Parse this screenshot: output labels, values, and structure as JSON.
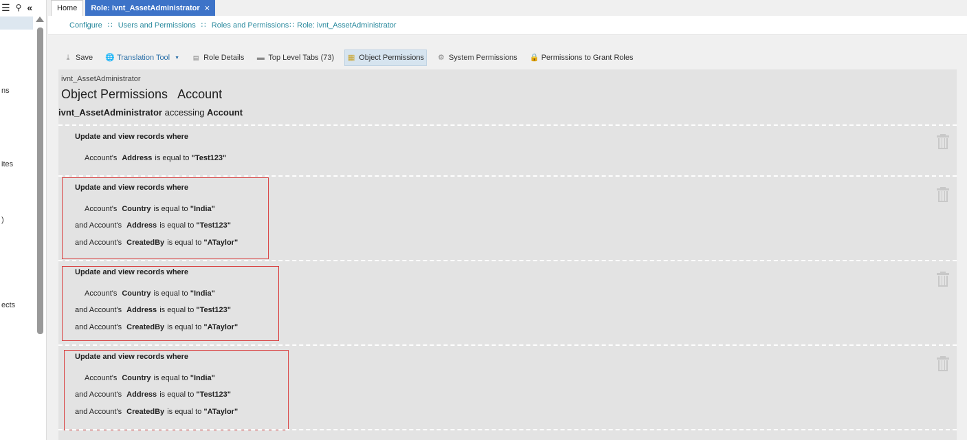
{
  "sidebar": {
    "tools": [
      "☰",
      "🔍",
      "«"
    ],
    "labels": [
      "ns",
      "ites",
      ")",
      "ects"
    ]
  },
  "tabs": {
    "home": "Home",
    "active": "Role: ivnt_AssetAdministrator",
    "close": "×"
  },
  "breadcrumb": [
    "Configure",
    "Users and Permissions",
    "Roles and Permissions",
    "Role: ivnt_AssetAdministrator"
  ],
  "breadcrumb_sep": "∷",
  "toolbar": {
    "save": "Save",
    "translation_tool": "Translation Tool",
    "role_details": "Role Details",
    "top_level_tabs": "Top Level Tabs (73)",
    "object_permissions": "Object Permissions",
    "system_permissions": "System Permissions",
    "permissions_to_grant_roles": "Permissions to Grant Roles"
  },
  "panel": {
    "role_small": "ivnt_AssetAdministrator",
    "title": "Object Permissions",
    "object": "Account",
    "accessing_role": "ivnt_AssetAdministrator",
    "accessing_word": "accessing",
    "accessing_object": "Account"
  },
  "blocks": [
    {
      "title": "Update and view records where",
      "conditions": [
        {
          "prefix": "Account's",
          "field": "Address",
          "op": "is equal to",
          "value": "\"Test123\""
        }
      ]
    },
    {
      "title": "Update and view records where",
      "conditions": [
        {
          "prefix": "Account's",
          "field": "Country",
          "op": "is equal to",
          "value": "\"India\""
        },
        {
          "prefix": "and Account's",
          "field": "Address",
          "op": "is equal to",
          "value": "\"Test123\""
        },
        {
          "prefix": "and Account's",
          "field": "CreatedBy",
          "op": "is equal to",
          "value": "\"ATaylor\""
        }
      ]
    },
    {
      "title": "Update and view records where",
      "conditions": [
        {
          "prefix": "Account's",
          "field": "Country",
          "op": "is equal to",
          "value": "\"India\""
        },
        {
          "prefix": "and Account's",
          "field": "Address",
          "op": "is equal to",
          "value": "\"Test123\""
        },
        {
          "prefix": "and Account's",
          "field": "CreatedBy",
          "op": "is equal to",
          "value": "\"ATaylor\""
        }
      ]
    },
    {
      "title": "Update and view records where",
      "conditions": [
        {
          "prefix": "Account's",
          "field": "Country",
          "op": "is equal to",
          "value": "\"India\""
        },
        {
          "prefix": "and Account's",
          "field": "Address",
          "op": "is equal to",
          "value": "\"Test123\""
        },
        {
          "prefix": "and Account's",
          "field": "CreatedBy",
          "op": "is equal to",
          "value": "\"ATaylor\""
        }
      ]
    }
  ]
}
